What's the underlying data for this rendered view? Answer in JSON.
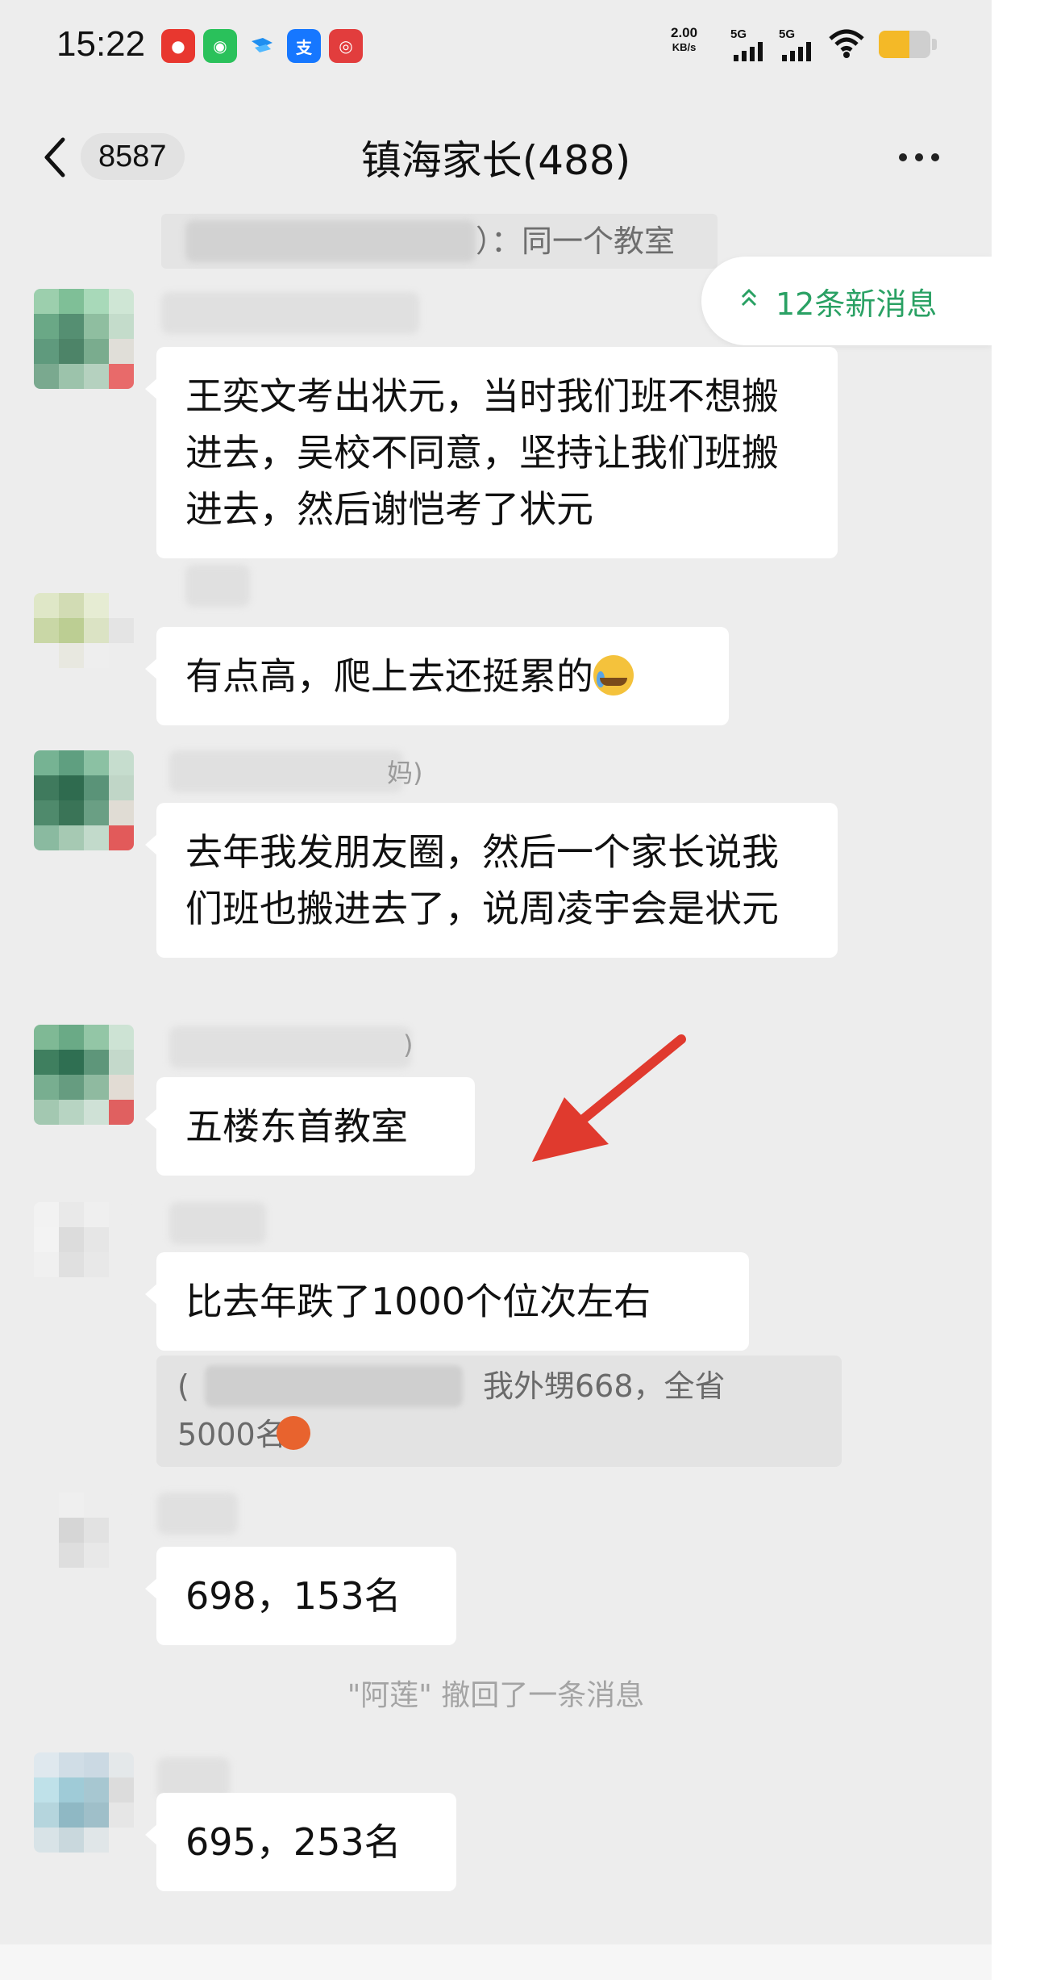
{
  "status_bar": {
    "time": "15:22",
    "net_speed_value": "2.00",
    "net_speed_unit": "KB/s",
    "signal_1": "5G",
    "signal_2": "5G",
    "battery_level": 0.6,
    "notification_icons": [
      "weibo-icon",
      "wechat-icon",
      "message-icon",
      "alipay-icon",
      "app-icon"
    ]
  },
  "header": {
    "unread_count": "8587",
    "title": "镇海家长(488)"
  },
  "new_messages_label": "12条新消息",
  "top_quote_text": "）：同一个教室",
  "messages": [
    {
      "text": "王奕文考出状元，当时我们班不想搬进去，吴校不同意，坚持让我们班搬进去，然后谢恺考了状元"
    },
    {
      "text": "有点高，爬上去还挺累的"
    },
    {
      "name_tail": "妈)",
      "text": "去年我发朋友圈，然后一个家长说我们班也搬进去了，说周凌宇会是状元"
    },
    {
      "name_tail": ")",
      "text": "五楼东首教室"
    },
    {
      "text": "比去年跌了1000个位次左右"
    },
    {
      "text": "698，153名"
    },
    {
      "text": "695，253名"
    }
  ],
  "quote": {
    "prefix": "(",
    "line1": "我外甥668，全省",
    "line2": "5000名"
  },
  "recall_notice": "\"阿莲\" 撤回了一条消息",
  "colors": {
    "background": "#ededed",
    "bubble": "#ffffff",
    "accent_green": "#2aa164",
    "arrow_red": "#e03a2e"
  }
}
